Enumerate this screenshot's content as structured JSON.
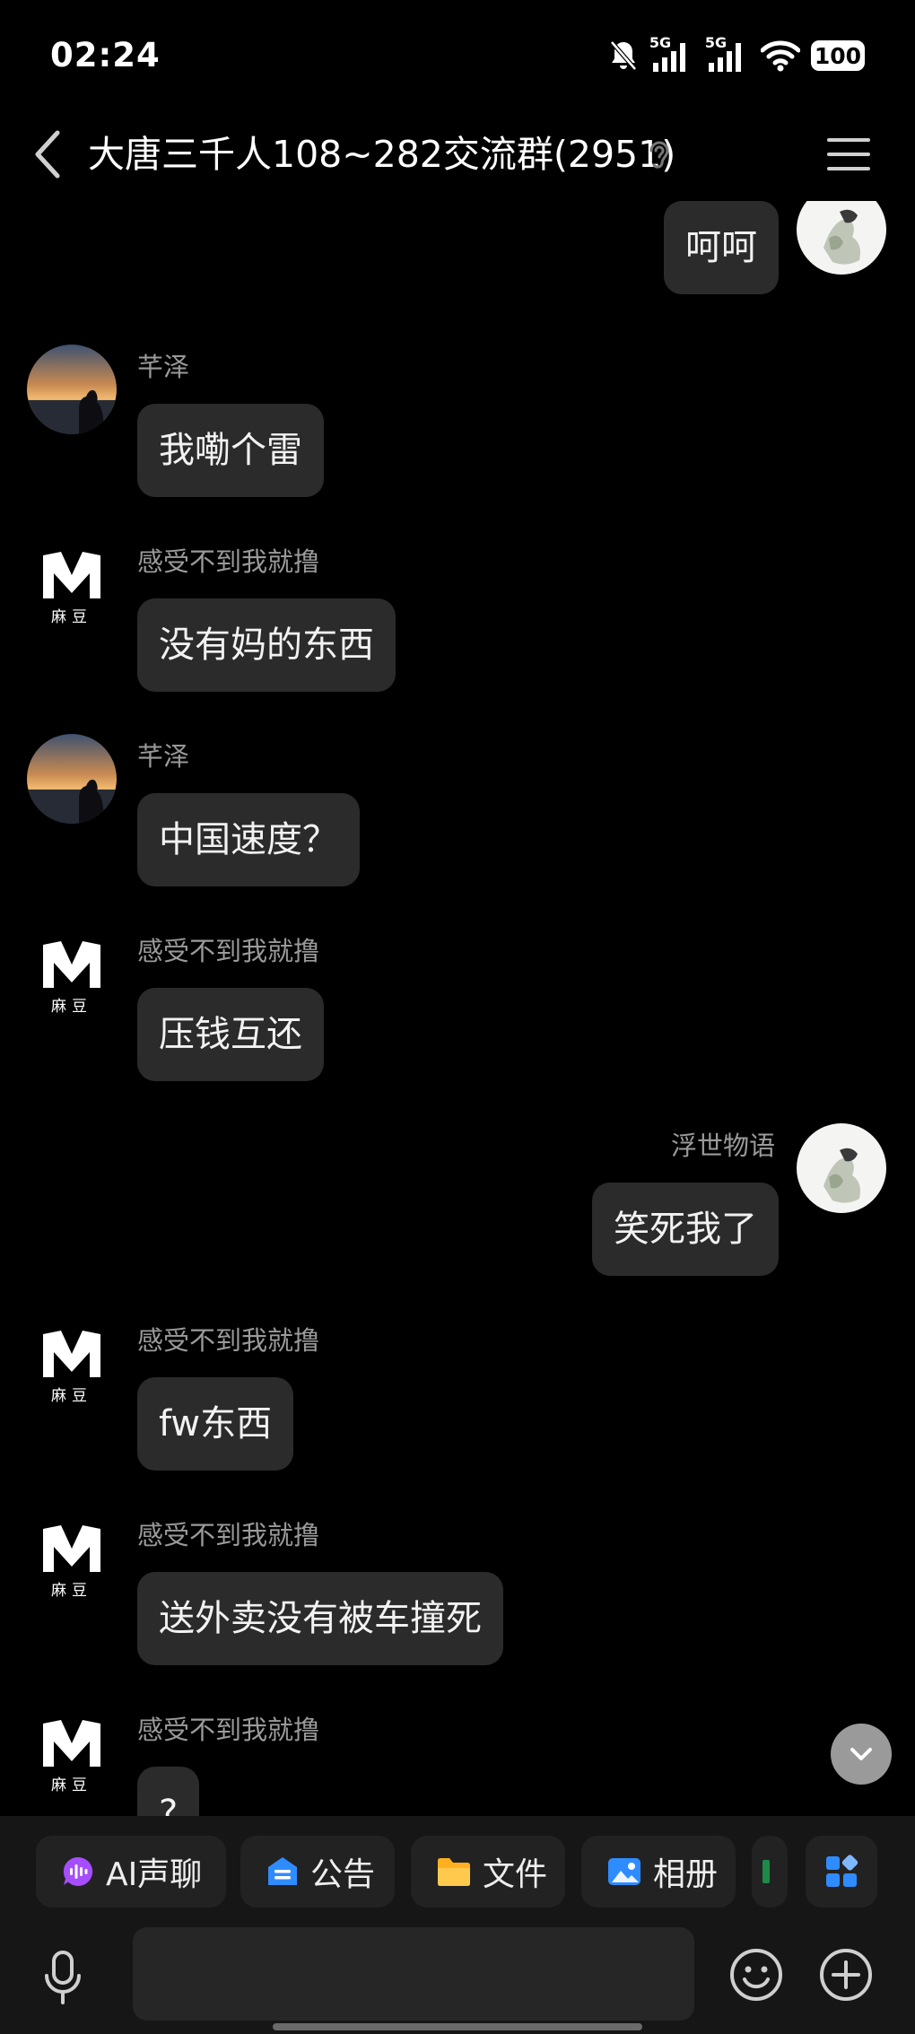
{
  "status_bar": {
    "time": "02:24",
    "signal_1": "5G",
    "signal_2": "5G",
    "battery": "100"
  },
  "header": {
    "title": "大唐三千人108~282交流群(2951)"
  },
  "messages": [
    {
      "side": "right",
      "sender": "",
      "text": "呵呵",
      "avatar": "self-avatar"
    },
    {
      "side": "left",
      "sender": "芊泽",
      "text": "我嘞个雷",
      "avatar": "sunset-avatar"
    },
    {
      "side": "left",
      "sender": "感受不到我就撸",
      "text": "没有妈的东西",
      "avatar": "madou-avatar"
    },
    {
      "side": "left",
      "sender": "芊泽",
      "text": "中国速度？",
      "avatar": "sunset-avatar"
    },
    {
      "side": "left",
      "sender": "感受不到我就撸",
      "text": "压钱互还",
      "avatar": "madou-avatar"
    },
    {
      "side": "right",
      "sender": "浮世物语",
      "text": "笑死我了",
      "avatar": "self-avatar"
    },
    {
      "side": "left",
      "sender": "感受不到我就撸",
      "text": "fw东西",
      "avatar": "madou-avatar"
    },
    {
      "side": "left",
      "sender": "感受不到我就撸",
      "text": "送外卖没有被车撞死",
      "avatar": "madou-avatar"
    },
    {
      "side": "left",
      "sender": "感受不到我就撸",
      "text": "?",
      "avatar": "madou-avatar"
    }
  ],
  "avatars": {
    "madou_label": "麻豆"
  },
  "toolbar": {
    "quick_actions": [
      {
        "label": "AI声聊",
        "icon": "ai-voice-icon",
        "color": "#a64dff"
      },
      {
        "label": "公告",
        "icon": "announcement-icon",
        "color": "#2f8cff"
      },
      {
        "label": "文件",
        "icon": "folder-icon",
        "color": "#ffb020"
      },
      {
        "label": "相册",
        "icon": "album-icon",
        "color": "#2f8cff"
      }
    ],
    "input_placeholder": ""
  },
  "colors": {
    "background": "#000000",
    "bubble": "#2b2b2b",
    "sender_name": "#9a9a9a",
    "toolbar": "#161616"
  }
}
